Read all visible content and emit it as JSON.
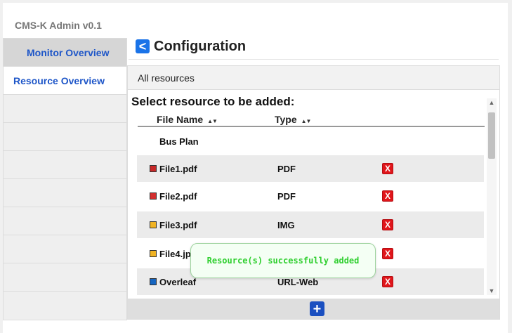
{
  "app": {
    "title": "CMS-K Admin v0.1"
  },
  "sidebar": {
    "items": [
      {
        "label": "Monitor Overview"
      },
      {
        "label": "Resource Overview"
      }
    ]
  },
  "header": {
    "back_icon": "<",
    "title": "Configuration"
  },
  "panel": {
    "heading": "All resources",
    "select_title": "Select resource to be added:",
    "columns": {
      "file_name": "File Name",
      "type": "Type",
      "sort_icon": "▲▼"
    },
    "rows": [
      {
        "name": "Bus Plan",
        "type": "",
        "icon_color": "",
        "deletable": false
      },
      {
        "name": "File1.pdf",
        "type": "PDF",
        "icon_color": "#c62828",
        "deletable": true
      },
      {
        "name": "File2.pdf",
        "type": "PDF",
        "icon_color": "#d32f2f",
        "deletable": true
      },
      {
        "name": "File3.pdf",
        "type": "IMG",
        "icon_color": "#f0b323",
        "deletable": true
      },
      {
        "name": "File4.jp",
        "type": "",
        "icon_color": "#f0b323",
        "deletable": true
      },
      {
        "name": "Overleaf",
        "type": "URL-Web",
        "icon_color": "#1565c0",
        "deletable": true
      }
    ],
    "delete_icon": "X",
    "add_icon": "+"
  },
  "scroll": {
    "up": "▲",
    "down": "▼"
  },
  "toast": {
    "message": "Resource(s) successfully added"
  }
}
